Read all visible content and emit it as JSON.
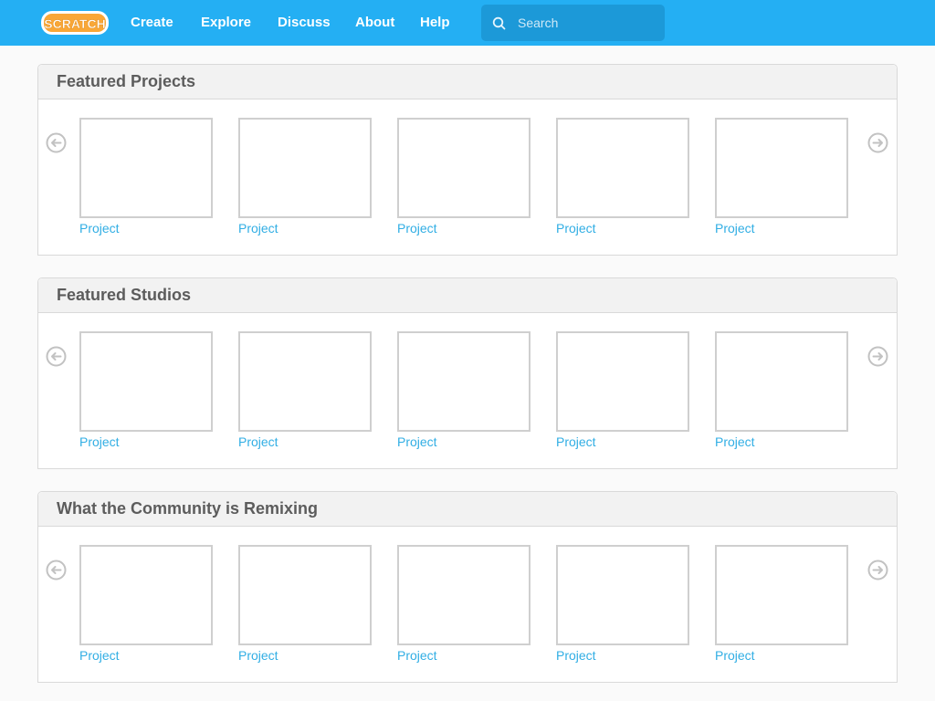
{
  "header": {
    "logo_text": "SCRATCH",
    "nav": [
      {
        "label": "Create"
      },
      {
        "label": "Explore"
      },
      {
        "label": "Discuss"
      },
      {
        "label": "About"
      },
      {
        "label": "Help"
      }
    ],
    "search": {
      "placeholder": "Search",
      "value": ""
    }
  },
  "sections": [
    {
      "title": "Featured Projects",
      "items": [
        {
          "label": "Project"
        },
        {
          "label": "Project"
        },
        {
          "label": "Project"
        },
        {
          "label": "Project"
        },
        {
          "label": "Project"
        }
      ]
    },
    {
      "title": "Featured Studios",
      "items": [
        {
          "label": "Project"
        },
        {
          "label": "Project"
        },
        {
          "label": "Project"
        },
        {
          "label": "Project"
        },
        {
          "label": "Project"
        }
      ]
    },
    {
      "title": "What the Community is Remixing",
      "items": [
        {
          "label": "Project"
        },
        {
          "label": "Project"
        },
        {
          "label": "Project"
        },
        {
          "label": "Project"
        },
        {
          "label": "Project"
        }
      ]
    }
  ],
  "icons": {
    "carousel_prev": "arrow-left-circle-icon",
    "carousel_next": "arrow-right-circle-icon",
    "search": "search-icon"
  },
  "colors": {
    "topbar": "#24aff3",
    "search_bg": "#1c99d8",
    "link": "#31aee4",
    "logo": "#f9a737"
  }
}
